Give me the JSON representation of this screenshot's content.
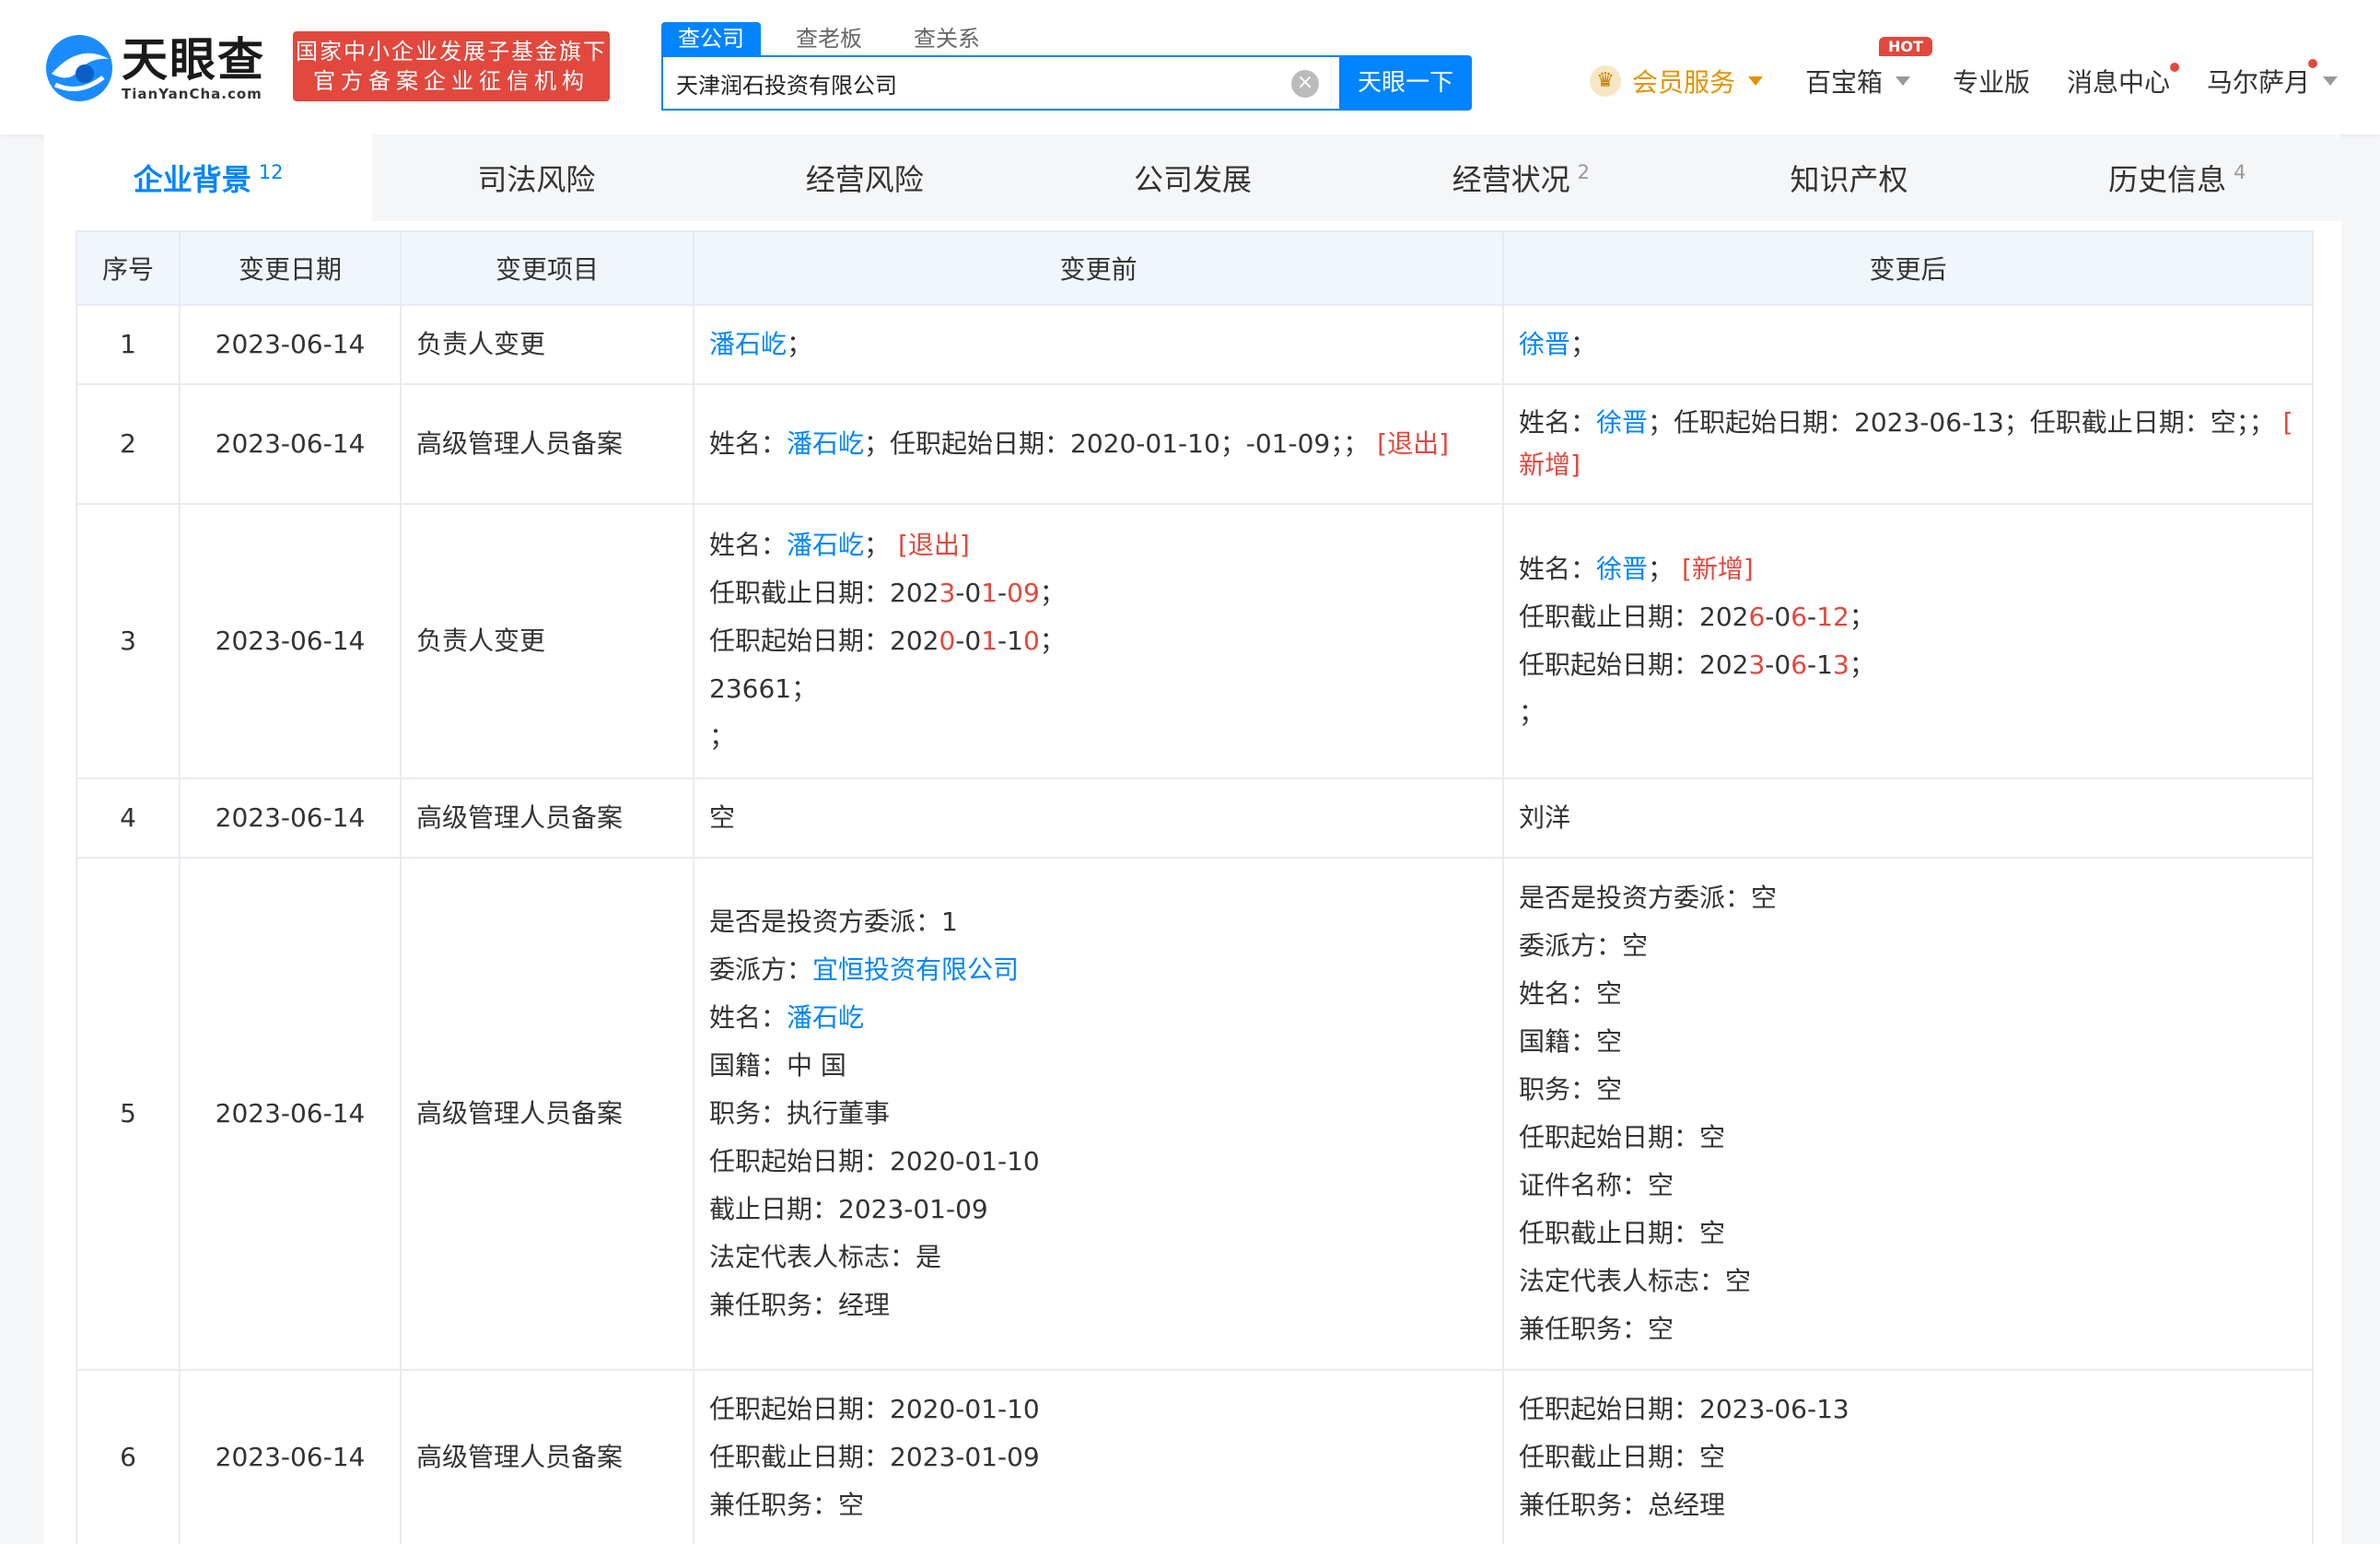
{
  "header": {
    "logo_cn": "天眼查",
    "logo_en": "TianYanCha.com",
    "badge_line1": "国家中小企业发展子基金旗下",
    "badge_line2": "官方备案企业征信机构",
    "search_tabs": [
      "查公司",
      "查老板",
      "查关系"
    ],
    "search_value": "天津润石投资有限公司",
    "search_button": "天眼一下",
    "vip": "会员服务",
    "baobox": "百宝箱",
    "hot": "HOT",
    "pro": "专业版",
    "messages": "消息中心",
    "user": "马尔萨月",
    "colors": {
      "brand": "#0084ff",
      "red": "#e2483d",
      "gold": "#e39300"
    }
  },
  "tabs": [
    {
      "label": "企业背景",
      "count": "12"
    },
    {
      "label": "司法风险",
      "count": ""
    },
    {
      "label": "经营风险",
      "count": ""
    },
    {
      "label": "公司发展",
      "count": ""
    },
    {
      "label": "经营状况",
      "count": "2"
    },
    {
      "label": "知识产权",
      "count": ""
    },
    {
      "label": "历史信息",
      "count": "4"
    }
  ],
  "table": {
    "headers": [
      "序号",
      "变更日期",
      "变更项目",
      "变更前",
      "变更后"
    ],
    "rows": [
      {
        "no": "1",
        "date": "2023-06-14",
        "item": "负责人变更",
        "before": {
          "name": "潘石屹",
          "suffix": "；"
        },
        "after": {
          "name": "徐晋",
          "suffix": "；"
        }
      },
      {
        "no": "2",
        "date": "2023-06-14",
        "item": "高级管理人员备案",
        "before": {
          "label": "姓名：",
          "name": "潘石屹",
          "rest": "；任职起始日期：2020-01-10；-01-09；；",
          "tag": "[退出]"
        },
        "after": {
          "label": "姓名：",
          "name": "徐晋",
          "rest": "；任职起始日期：2023-06-13；任职截止日期：空；；",
          "tag_open": "[",
          "tag_text": "新增]"
        }
      },
      {
        "no": "3",
        "date": "2023-06-14",
        "item": "负责人变更",
        "before": {
          "label": "姓名：",
          "name": "潘石屹",
          "sep": "；",
          "tag": "[退出]",
          "end_label": "任职截止日期：",
          "end_parts": [
            "202",
            "3",
            "-0",
            "1",
            "-",
            "09",
            "；"
          ],
          "start_label": "任职起始日期：",
          "start_parts": [
            "202",
            "0",
            "-0",
            "1",
            "-1",
            "0",
            "；"
          ],
          "extra1": "23661；",
          "extra2": "；"
        },
        "after": {
          "label": "姓名：",
          "name": "徐晋",
          "sep": "；",
          "tag": "[新增]",
          "end_label": "任职截止日期：",
          "end_parts": [
            "202",
            "6",
            "-0",
            "6",
            "-",
            "12",
            "；"
          ],
          "start_label": "任职起始日期：",
          "start_parts": [
            "202",
            "3",
            "-0",
            "6",
            "-1",
            "3",
            "；"
          ],
          "extra1": "；"
        }
      },
      {
        "no": "4",
        "date": "2023-06-14",
        "item": "高级管理人员备案",
        "before_text": "空",
        "after_text": "刘洋"
      },
      {
        "no": "5",
        "date": "2023-06-14",
        "item": "高级管理人员备案",
        "before_lines": [
          {
            "text": "是否是投资方委派：1"
          },
          {
            "label": "委派方：",
            "link": "宜恒投资有限公司"
          },
          {
            "label": "姓名：",
            "link": "潘石屹"
          },
          {
            "text": "国籍：中 国"
          },
          {
            "text": "职务：执行董事"
          },
          {
            "text": "任职起始日期：2020-01-10"
          },
          {
            "text": "截止日期：2023-01-09"
          },
          {
            "text": "法定代表人标志：是"
          },
          {
            "text": "兼任职务：经理"
          }
        ],
        "after_lines": [
          "是否是投资方委派：空",
          "委派方：空",
          "姓名：空",
          "国籍：空",
          "职务：空",
          "任职起始日期：空",
          "证件名称：空",
          "任职截止日期：空",
          "法定代表人标志：空",
          "兼任职务：空"
        ]
      },
      {
        "no": "6",
        "date": "2023-06-14",
        "item": "高级管理人员备案",
        "before_lines": [
          "任职起始日期：2020-01-10",
          "任职截止日期：2023-01-09",
          "兼任职务：空"
        ],
        "after_lines": [
          "任职起始日期：2023-06-13",
          "任职截止日期：空",
          "兼任职务：总经理"
        ]
      }
    ]
  }
}
